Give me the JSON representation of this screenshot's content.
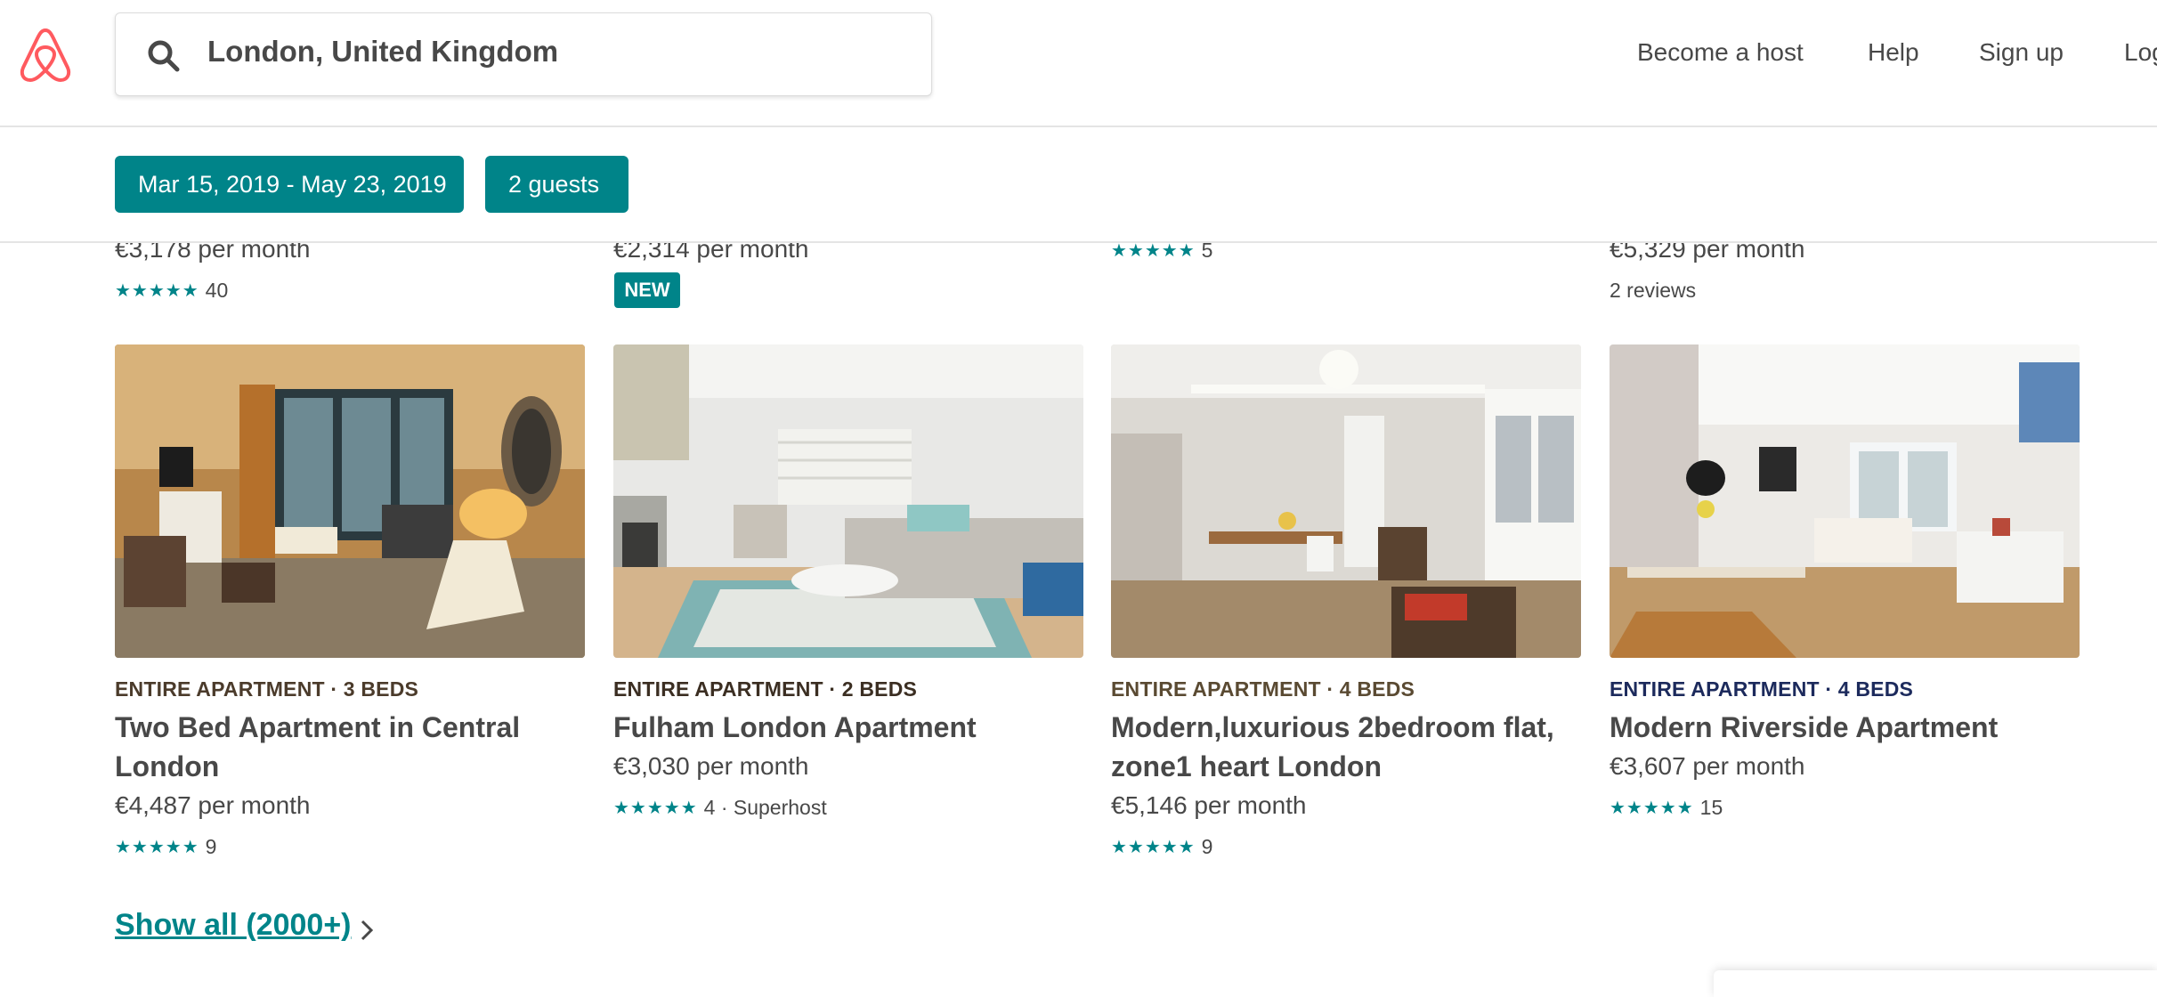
{
  "header": {
    "search_value": "London, United Kingdom",
    "nav": [
      "Become a host",
      "Help",
      "Sign up",
      "Log"
    ]
  },
  "filters": {
    "dates": "Mar 15, 2019 - May 23, 2019",
    "guests": "2 guests"
  },
  "top_row": [
    {
      "price": "€3,178 per month",
      "stars": "★★★★★",
      "rating": "40"
    },
    {
      "price": "€2,314 per month",
      "badge": "NEW"
    },
    {
      "stars": "★★★★★",
      "rating": "5"
    },
    {
      "price": "€5,329 per month",
      "rating": "2 reviews"
    }
  ],
  "listings": [
    {
      "kicker": "ENTIRE APARTMENT · 3 BEDS",
      "kicker_color": "#4b3b2b",
      "title": "Two Bed Apartment in Central London",
      "price": "€4,487 per month",
      "stars": "★★★★★",
      "rating": "9"
    },
    {
      "kicker": "ENTIRE APARTMENT · 2 BEDS",
      "kicker_color": "#3b2e22",
      "title": "Fulham London Apartment",
      "price": "€3,030 per month",
      "stars": "★★★★★",
      "rating": "4 · Superhost"
    },
    {
      "kicker": "ENTIRE APARTMENT · 4 BEDS",
      "kicker_color": "#5a4a32",
      "title": "Modern,luxurious 2bedroom flat, zone1 heart London",
      "price": "€5,146 per month",
      "stars": "★★★★★",
      "rating": "9"
    },
    {
      "kicker": "ENTIRE APARTMENT · 4 BEDS",
      "kicker_color": "#1c2a5c",
      "title": "Modern Riverside Apartment",
      "price": "€3,607 per month",
      "stars": "★★★★★",
      "rating": "15"
    }
  ],
  "show_all": "Show all (2000+)",
  "colors": {
    "accent": "#008489",
    "brand": "#ff5a5f",
    "text": "#484848"
  }
}
